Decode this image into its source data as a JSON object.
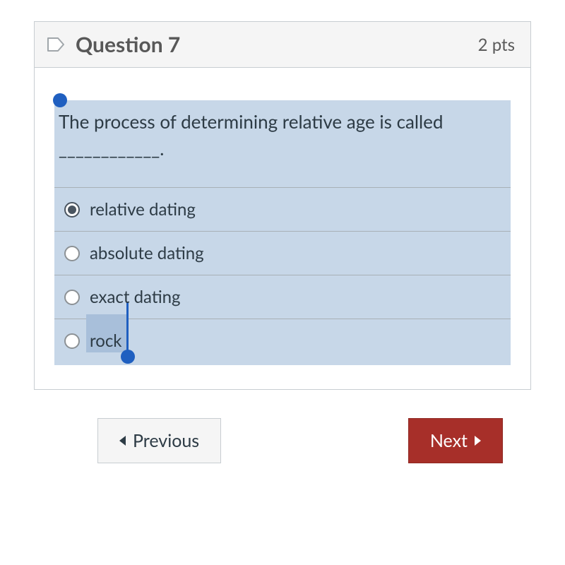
{
  "header": {
    "title": "Question 7",
    "points": "2 pts"
  },
  "question": {
    "text": "The process of determining relative age is called ____________."
  },
  "options": [
    {
      "label": "relative dating",
      "selected": true
    },
    {
      "label": "absolute dating",
      "selected": false
    },
    {
      "label": "exact dating",
      "selected": false
    },
    {
      "label": "rock",
      "selected": false
    }
  ],
  "nav": {
    "prev": "Previous",
    "next": "Next"
  }
}
